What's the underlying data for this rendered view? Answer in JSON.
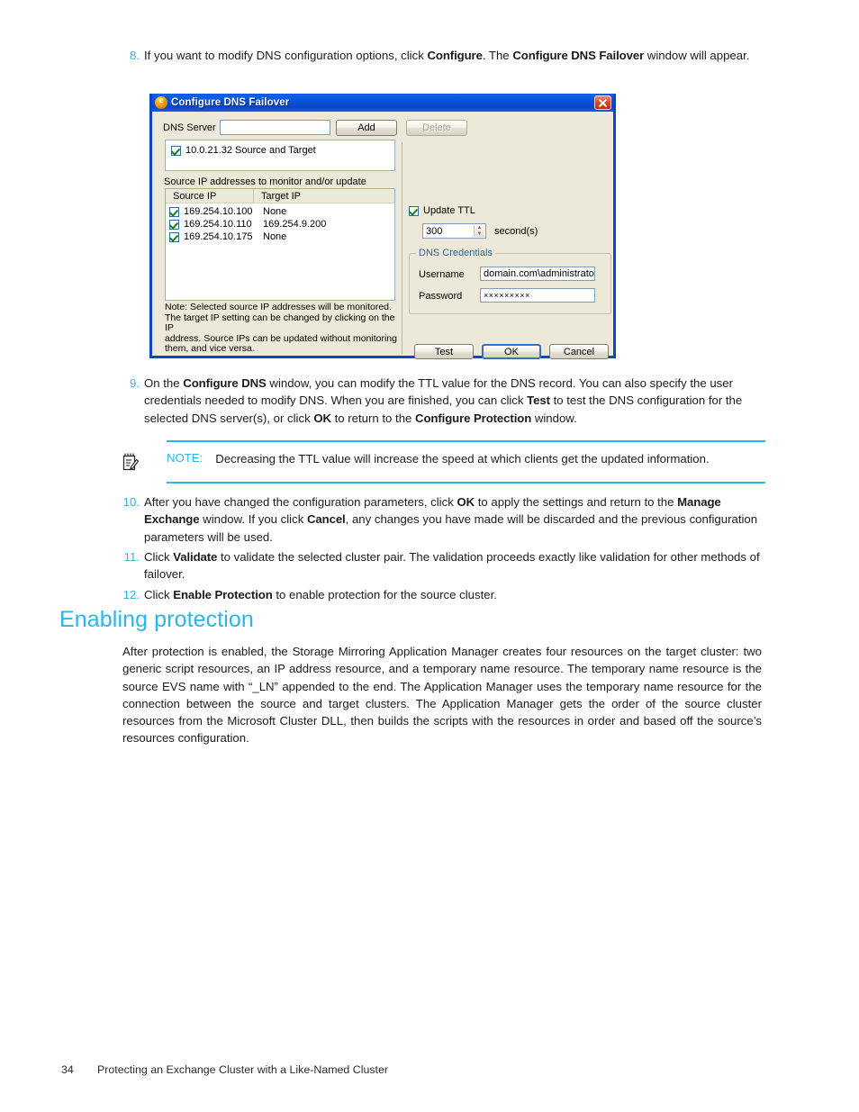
{
  "document": {
    "steps": [
      {
        "number": "8.",
        "html": "If you want to modify DNS configuration options, click <b>Configure</b>. The <b>Configure DNS Failover</b> window will appear."
      },
      {
        "number": "9.",
        "html": "On the <b>Configure DNS</b> window, you can modify the TTL value for the DNS record. You can also specify the user credentials needed to modify DNS. When you are finished, you can click <b>Test</b> to test the DNS configuration for the selected DNS server(s), or click <b>OK</b> to return to the <b>Configure Protection</b> window."
      },
      {
        "number": "10.",
        "html": "After you have changed the configuration parameters, click <b>OK</b> to apply the settings and return to the <b>Manage Exchange</b> window. If you click <b>Cancel</b>, any changes you have made will be discarded and the previous configuration parameters will be used."
      },
      {
        "number": "11.",
        "html": "Click <b>Validate</b> to validate the selected cluster pair. The validation proceeds exactly like validation for other methods of failover."
      },
      {
        "number": "12.",
        "html": "Click <b>Enable Protection</b> to enable protection for the source cluster."
      }
    ],
    "note": {
      "label": "NOTE:",
      "text": "Decreasing the TTL value will increase the speed at which clients get the updated information.",
      "rule_color": "#2bb5e8"
    },
    "section_heading": "Enabling protection",
    "section_heading_color": "#2bb5e8",
    "section_paragraph": "After protection is enabled, the Storage Mirroring Application Manager creates four resources on the target cluster: two generic script resources, an IP address resource, and a temporary name resource. The temporary name resource is the source EVS name with “_LN” appended to the end. The Application Manager uses the temporary name resource for the connection between the source and target clusters. The Application Manager gets the order of the source cluster resources from the Microsoft Cluster DLL, then builds the scripts with the resources in order and based off the source’s resources configuration.",
    "footer": {
      "page_number": "34",
      "title": "Protecting an Exchange Cluster with a Like-Named Cluster"
    }
  },
  "dialog": {
    "title": "Configure DNS Failover",
    "titlebar_color": "#0b52d6",
    "close_button": "close-icon",
    "dns_server": {
      "label": "DNS Server",
      "value": "",
      "placeholder": "",
      "add_label": "Add",
      "delete_label": "Delete",
      "delete_disabled": true
    },
    "server_list": [
      {
        "checked": true,
        "text": "10.0.21.32   Source and Target"
      }
    ],
    "source_ip_section": {
      "label": "Source IP addresses to monitor and/or update",
      "columns": [
        "Source IP",
        "Target IP"
      ],
      "rows": [
        {
          "checked": true,
          "source_ip": "169.254.10.100",
          "target_ip": "None"
        },
        {
          "checked": true,
          "source_ip": "169.254.10.110",
          "target_ip": "169.254.9.200"
        },
        {
          "checked": true,
          "source_ip": "169.254.10.175",
          "target_ip": "None"
        }
      ]
    },
    "note_text": "Note: Selected source IP addresses will be monitored.\nThe target IP setting can be changed by clicking on the IP\naddress.  Source IPs can be updated without monitoring\nthem, and vice versa.",
    "update_ttl": {
      "label": "Update TTL",
      "checked": true,
      "value": "300",
      "units": "second(s)"
    },
    "dns_credentials": {
      "group_title": "DNS Credentials",
      "group_title_color": "#33669e",
      "username_label": "Username",
      "username_value": "domain.com\\administrator",
      "password_label": "Password",
      "password_value": "×××××××××"
    },
    "buttons": {
      "test": "Test",
      "ok": "OK",
      "cancel": "Cancel"
    }
  }
}
